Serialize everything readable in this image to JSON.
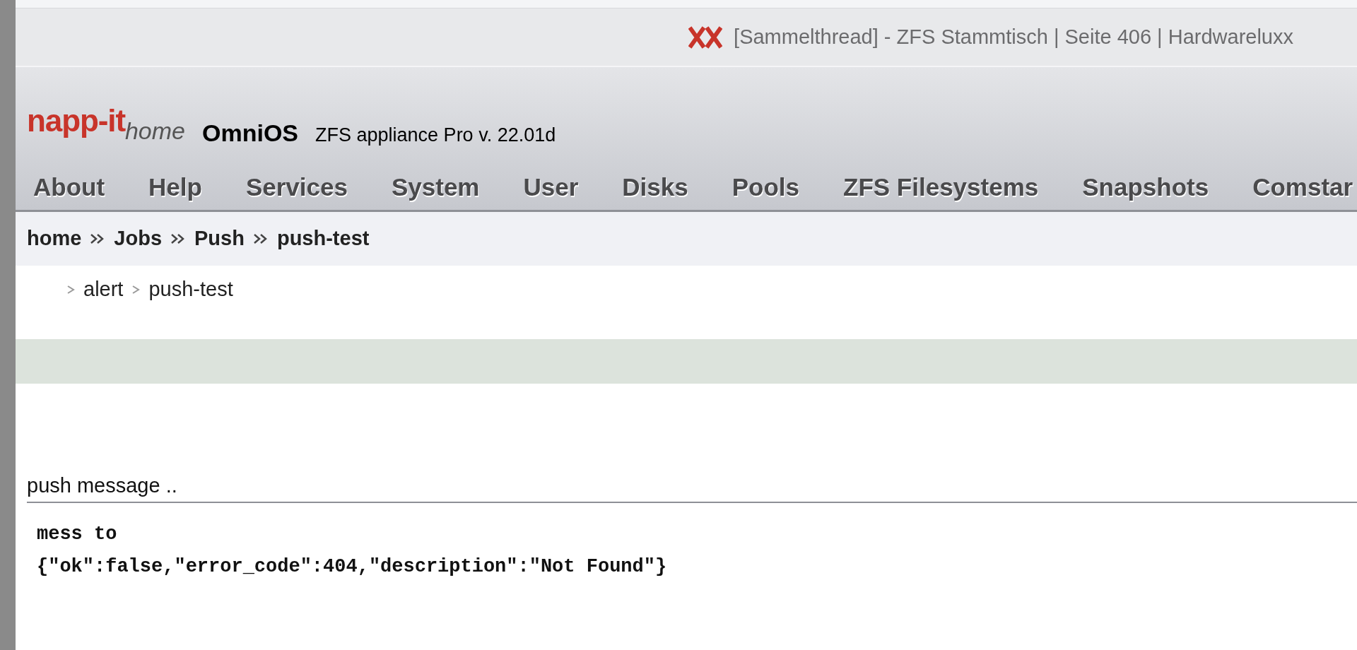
{
  "browser": {
    "title": "[Sammelthread] - ZFS Stammtisch | Seite 406 | Hardwareluxx"
  },
  "header": {
    "logo_name": "napp-it",
    "logo_suffix": "home",
    "os": "OmniOS",
    "version": "ZFS appliance Pro v. 22.01d"
  },
  "nav": [
    {
      "label": "About"
    },
    {
      "label": "Help"
    },
    {
      "label": "Services"
    },
    {
      "label": "System"
    },
    {
      "label": "User"
    },
    {
      "label": "Disks"
    },
    {
      "label": "Pools"
    },
    {
      "label": "ZFS Filesystems"
    },
    {
      "label": "Snapshots"
    },
    {
      "label": "Comstar"
    }
  ],
  "breadcrumb": [
    {
      "label": "home"
    },
    {
      "label": "Jobs"
    },
    {
      "label": "Push"
    },
    {
      "label": "push-test"
    }
  ],
  "subnav": [
    {
      "label": "alert"
    },
    {
      "label": "push-test"
    }
  ],
  "section": {
    "title": "push message ..",
    "output": [
      "mess to",
      "{\"ok\":false,\"error_code\":404,\"description\":\"Not Found\"}"
    ]
  }
}
